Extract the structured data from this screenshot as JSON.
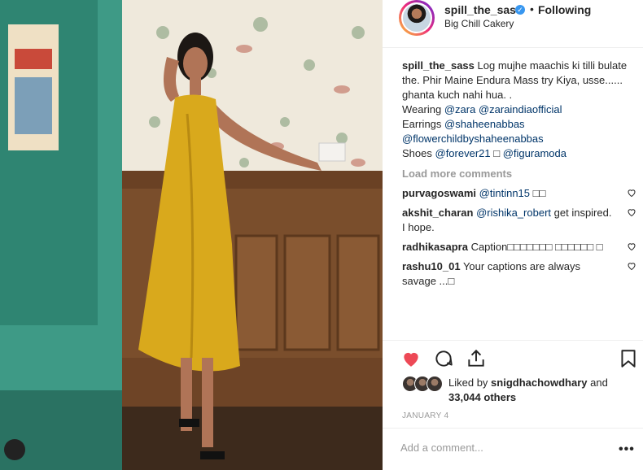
{
  "post": {
    "username": "spill_the_sass",
    "follow_separator": "•",
    "follow_label": "Following",
    "location": "Big Chill Cakery"
  },
  "caption": {
    "username": "spill_the_sass",
    "text": "Log mujhe maachis ki tilli bulate the. Phir Maine Endura Mass try Kiya, usse...... ghanta kuch nahi hua. .",
    "wearing_label": "Wearing",
    "wearing_tags": [
      "@zara",
      "@zaraindiaofficial"
    ],
    "earrings_label": "Earrings",
    "earrings_tag": "@shaheenabbas",
    "second_tag": "@flowerchildbyshaheenabbas",
    "shoes_label": "Shoes",
    "shoes_tag": "@forever21",
    "shoes_sep": "□",
    "shoes_tag2": "@figuramoda"
  },
  "load_more": "Load more comments",
  "comments": [
    {
      "user": "purvagoswami",
      "mention": "@tintinn15",
      "text": "□□"
    },
    {
      "user": "akshit_charan",
      "mention": "@rishika_robert",
      "text": "get inspired. I hope."
    },
    {
      "user": "radhikasapra",
      "mention": "",
      "text": "Caption□□□□□□□ □□□□□□ □"
    },
    {
      "user": "rashu10_01",
      "mention": "",
      "text": "Your captions are always savage ...□"
    }
  ],
  "likes": {
    "prefix": "Liked by",
    "user": "snigdhachowdhary",
    "middle": "and",
    "count": "33,044 others"
  },
  "date": "JANUARY 4",
  "add_comment_placeholder": "Add a comment...",
  "more_label": "•••",
  "icons": {
    "like": "heart-filled-icon",
    "comment": "comment-icon",
    "share": "share-icon",
    "save": "bookmark-icon"
  },
  "colors": {
    "heart": "#ed4956",
    "link": "#003569",
    "verified": "#3897f0",
    "dress": "#d9a91c"
  }
}
